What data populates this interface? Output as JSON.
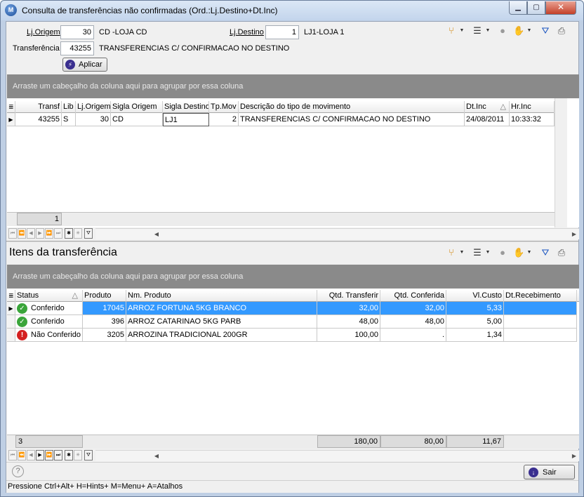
{
  "window": {
    "title": "Consulta de transferências não confirmadas (Ord.:Lj.Destino+Dt.Inc)",
    "min_glyph": "▁",
    "max_glyph": "▢",
    "close_glyph": "✕"
  },
  "filters": {
    "lj_origem_label": "Lj.Origem",
    "lj_origem_value": "30",
    "lj_origem_desc": "CD -LOJA CD",
    "lj_destino_label": "Lj.Destino",
    "lj_destino_value": "1",
    "lj_destino_desc": "LJ1-LOJA 1",
    "transferencia_label": "Transferência",
    "transferencia_value": "43255",
    "transferencia_desc": "TRANSFERENCIAS C/ CONFIRMACAO NO DESTINO",
    "aplicar_label": "Aplicar"
  },
  "top_grid": {
    "group_hint": "Arraste um cabeçalho da coluna aqui para agrupar por essa coluna",
    "columns": [
      "Transf",
      "Lib",
      "Lj.Origem",
      "Sigla Origem",
      "Sigla Destino",
      "Tp.Mov",
      "Descrição do tipo de movimento",
      "Dt.Inc",
      "Hr.Inc"
    ],
    "sort_glyph": "△",
    "rows": [
      {
        "transf": "43255",
        "lib": "S",
        "lj_origem": "30",
        "sigla_origem": "CD",
        "sigla_destino": "LJ1",
        "tp_mov": "2",
        "descricao": "TRANSFERENCIAS C/ CONFIRMACAO NO DESTINO",
        "dt_inc": "24/08/2011",
        "hr_inc": "10:33:32"
      }
    ],
    "footer_count": "1"
  },
  "items_section": {
    "title": "Itens da transferência",
    "group_hint": "Arraste um cabeçalho da coluna aqui para agrupar por essa coluna",
    "columns": [
      "Status",
      "Produto",
      "Nm. Produto",
      "Qtd. Transferir",
      "Qtd. Conferida",
      "Vl.Custo",
      "Dt.Recebimento"
    ],
    "sort_glyph": "△",
    "rows": [
      {
        "status": "Conferido",
        "status_kind": "ok",
        "produto": "17045",
        "nome": "ARROZ FORTUNA 5KG BRANCO",
        "qtd_transferir": "32,00",
        "qtd_conferida": "32,00",
        "vl_custo": "5,33",
        "dt_recebimento": ""
      },
      {
        "status": "Conferido",
        "status_kind": "ok",
        "produto": "396",
        "nome": "ARROZ CATARINAO 5KG PARB",
        "qtd_transferir": "48,00",
        "qtd_conferida": "48,00",
        "vl_custo": "5,00",
        "dt_recebimento": ""
      },
      {
        "status": "Não Conferido",
        "status_kind": "warn",
        "produto": "3205",
        "nome": "ARROZINA TRADICIONAL 200GR",
        "qtd_transferir": "100,00",
        "qtd_conferida": ".",
        "vl_custo": "1,34",
        "dt_recebimento": ""
      }
    ],
    "footer": {
      "count": "3",
      "qtd_transferir": "180,00",
      "qtd_conferida": "80,00",
      "vl_custo": "11,67"
    }
  },
  "bottom": {
    "help_glyph": "?",
    "sair_label": "Sair"
  },
  "statusbar": {
    "text": "Pressione Ctrl+Alt+ H=Hints+ M=Menu+ A=Atalhos"
  },
  "colors": {
    "selection": "#3399ff",
    "group_bar": "#8a8a8a",
    "ok_icon": "#3aa53a",
    "warn_icon": "#d42020"
  },
  "icons": [
    "app-icon",
    "tree-icon",
    "list-icon",
    "circle-icon",
    "hand-icon",
    "filter-icon",
    "printer-icon",
    "lightning-icon",
    "exit-icon",
    "help-icon",
    "check-icon",
    "exclamation-icon"
  ]
}
